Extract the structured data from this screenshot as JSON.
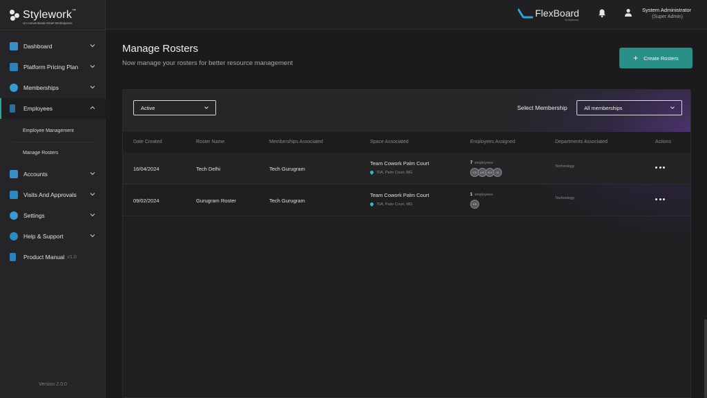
{
  "brand": {
    "name": "Stylework",
    "trademark": "™",
    "tagline": "Un-conventional Smart Workspaces"
  },
  "sidebar": {
    "items": [
      {
        "label": "Dashboard",
        "icon": "dashboard-icon",
        "color": "#3aa7d8"
      },
      {
        "label": "Platform Pricing Plan",
        "icon": "pricing-icon",
        "color": "#3a9ad8"
      },
      {
        "label": "Memberships",
        "icon": "membership-icon",
        "color": "#3aa7d8"
      },
      {
        "label": "Employees",
        "icon": "employees-icon",
        "color": "#3aa7d8"
      },
      {
        "label": "Accounts",
        "icon": "accounts-icon",
        "color": "#3aa7d8"
      },
      {
        "label": "Visits And Approvals",
        "icon": "visits-icon",
        "color": "#3aa7d8"
      },
      {
        "label": "Settings",
        "icon": "settings-icon",
        "color": "#3aa7d8"
      },
      {
        "label": "Help & Support",
        "icon": "help-icon",
        "color": "#3aa7d8"
      },
      {
        "label": "Product Manual",
        "version": "v1.0",
        "icon": "manual-icon",
        "color": "#3aa7d8"
      }
    ],
    "employees_sub": [
      {
        "label": "Employee Management"
      },
      {
        "label": "Manage Rosters"
      }
    ],
    "app_version": "Version 2.0.0"
  },
  "topbar": {
    "product": "FlexBoard",
    "product_by": "by Stylework",
    "user_name": "System Administrator",
    "user_role": "(Super Admin)"
  },
  "page": {
    "title": "Manage Rosters",
    "subtitle": "Now manage your rosters for better resource management",
    "create_label": "Create Rosters"
  },
  "filters": {
    "status_value": "Active",
    "membership_label": "Select Membership",
    "membership_value": "All memberships"
  },
  "table": {
    "headers": [
      "Date Created",
      "Roster Name",
      "Memberships Associated",
      "Space Associated",
      "Employees Assigned",
      "Departments Associated",
      "Actions"
    ],
    "rows": [
      {
        "date": "16/04/2024",
        "name": "Tech Delhi",
        "membership": "Tech Gurugram",
        "space": "Team Cowork Palm Court",
        "location": "70A, Palm Court, MG",
        "emp_count": "7",
        "emp_word": "employees",
        "avatars": [
          "V.S",
          "D.R",
          "R.S",
          "+4"
        ],
        "department": "Technology"
      },
      {
        "date": "09/02/2024",
        "name": "Gurugram Roster",
        "membership": "Tech Gurugram",
        "space": "Team Cowork Palm Court",
        "location": "70A, Palm Court, MG",
        "emp_count": "1",
        "emp_word": "employees",
        "avatars": [
          "V.S"
        ],
        "department": "Technology"
      }
    ]
  },
  "colors": {
    "accent": "#2a8f86",
    "active_border": "#2aa89a",
    "glow": "#6a3ca0"
  }
}
